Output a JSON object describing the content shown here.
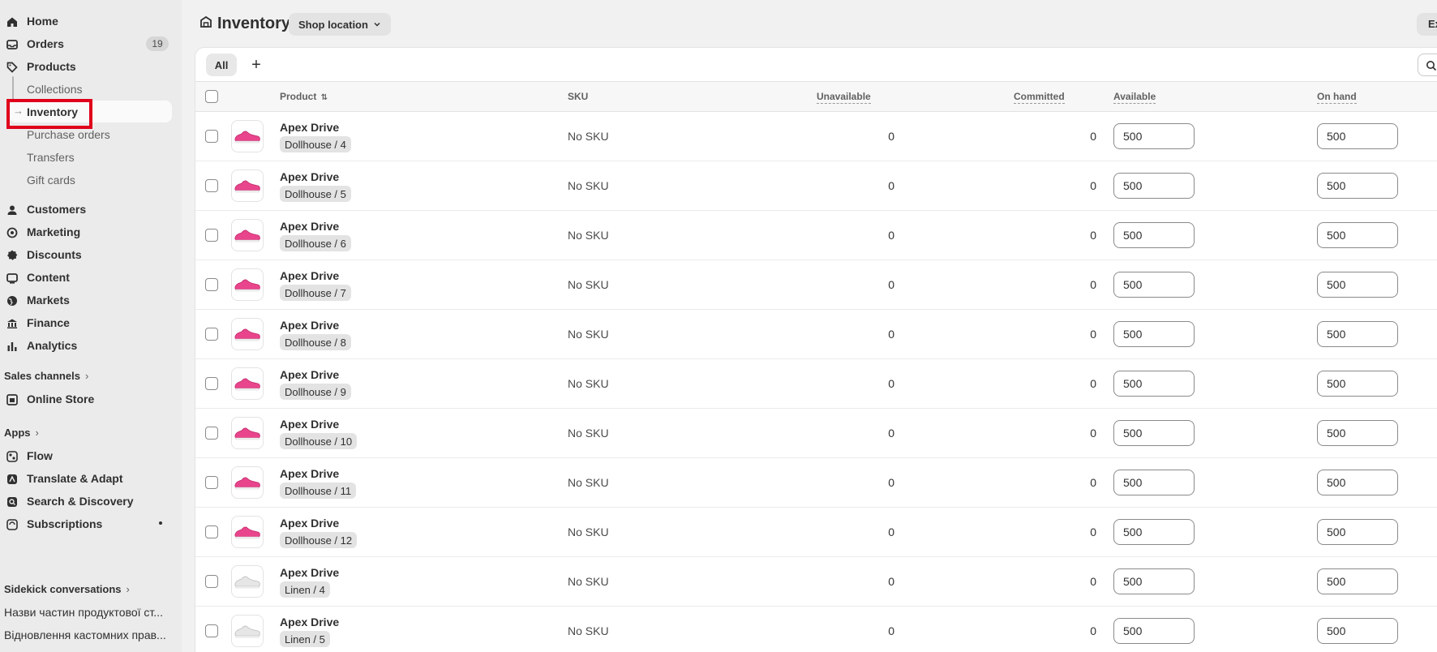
{
  "sidebar": {
    "items": [
      {
        "label": "Home",
        "icon": "home-icon"
      },
      {
        "label": "Orders",
        "icon": "inbox-icon",
        "badge": "19"
      },
      {
        "label": "Products",
        "icon": "tag-icon"
      }
    ],
    "product_subitems": [
      "Collections",
      "Inventory",
      "Purchase orders",
      "Transfers",
      "Gift cards"
    ],
    "items2": [
      {
        "label": "Customers",
        "icon": "person-icon"
      },
      {
        "label": "Marketing",
        "icon": "target-icon"
      },
      {
        "label": "Discounts",
        "icon": "discount-icon"
      },
      {
        "label": "Content",
        "icon": "content-icon"
      },
      {
        "label": "Markets",
        "icon": "globe-icon"
      },
      {
        "label": "Finance",
        "icon": "bank-icon"
      },
      {
        "label": "Analytics",
        "icon": "bar-chart-icon"
      }
    ],
    "sales_channels_label": "Sales channels",
    "online_store": "Online Store",
    "apps_label": "Apps",
    "apps": [
      "Flow",
      "Translate & Adapt",
      "Search & Discovery",
      "Subscriptions"
    ],
    "sidekick_label": "Sidekick conversations",
    "conversations": [
      "Назви частин продуктової ст...",
      "Відновлення кастомних прав..."
    ]
  },
  "header": {
    "title": "Inventory",
    "location_button": "Shop location",
    "export_button": "Ex"
  },
  "tabs": {
    "all": "All",
    "add": "+"
  },
  "table": {
    "columns": {
      "product": "Product",
      "sku": "SKU",
      "unavailable": "Unavailable",
      "committed": "Committed",
      "available": "Available",
      "on_hand": "On hand"
    },
    "rows": [
      {
        "name": "Apex Drive",
        "variant": "Dollhouse / 4",
        "sku": "No SKU",
        "unavailable": "0",
        "committed": "0",
        "available": "500",
        "on_hand": "500",
        "color": "pink"
      },
      {
        "name": "Apex Drive",
        "variant": "Dollhouse / 5",
        "sku": "No SKU",
        "unavailable": "0",
        "committed": "0",
        "available": "500",
        "on_hand": "500",
        "color": "pink"
      },
      {
        "name": "Apex Drive",
        "variant": "Dollhouse / 6",
        "sku": "No SKU",
        "unavailable": "0",
        "committed": "0",
        "available": "500",
        "on_hand": "500",
        "color": "pink"
      },
      {
        "name": "Apex Drive",
        "variant": "Dollhouse / 7",
        "sku": "No SKU",
        "unavailable": "0",
        "committed": "0",
        "available": "500",
        "on_hand": "500",
        "color": "pink"
      },
      {
        "name": "Apex Drive",
        "variant": "Dollhouse / 8",
        "sku": "No SKU",
        "unavailable": "0",
        "committed": "0",
        "available": "500",
        "on_hand": "500",
        "color": "pink"
      },
      {
        "name": "Apex Drive",
        "variant": "Dollhouse / 9",
        "sku": "No SKU",
        "unavailable": "0",
        "committed": "0",
        "available": "500",
        "on_hand": "500",
        "color": "pink"
      },
      {
        "name": "Apex Drive",
        "variant": "Dollhouse / 10",
        "sku": "No SKU",
        "unavailable": "0",
        "committed": "0",
        "available": "500",
        "on_hand": "500",
        "color": "pink"
      },
      {
        "name": "Apex Drive",
        "variant": "Dollhouse / 11",
        "sku": "No SKU",
        "unavailable": "0",
        "committed": "0",
        "available": "500",
        "on_hand": "500",
        "color": "pink"
      },
      {
        "name": "Apex Drive",
        "variant": "Dollhouse / 12",
        "sku": "No SKU",
        "unavailable": "0",
        "committed": "0",
        "available": "500",
        "on_hand": "500",
        "color": "pink"
      },
      {
        "name": "Apex Drive",
        "variant": "Linen / 4",
        "sku": "No SKU",
        "unavailable": "0",
        "committed": "0",
        "available": "500",
        "on_hand": "500",
        "color": "white"
      },
      {
        "name": "Apex Drive",
        "variant": "Linen / 5",
        "sku": "No SKU",
        "unavailable": "0",
        "committed": "0",
        "available": "500",
        "on_hand": "500",
        "color": "white"
      }
    ]
  },
  "colors": {
    "highlight": "#e0001b",
    "pink_shoe": "#e8458c",
    "white_shoe": "#e6e6e6"
  }
}
